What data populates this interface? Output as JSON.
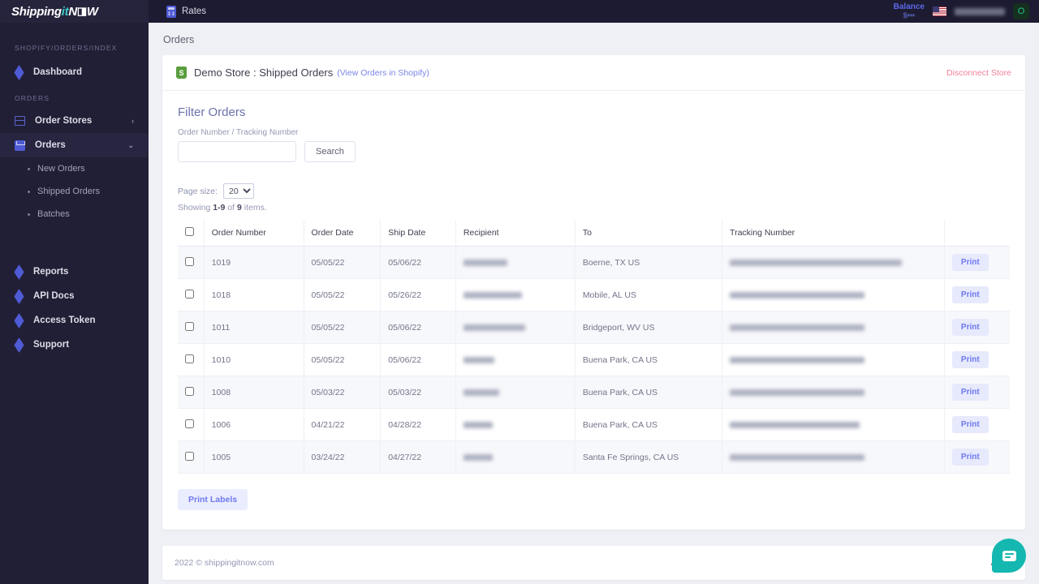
{
  "brand": {
    "part1": "Shipping",
    "part2": "it",
    "part3": "N",
    "part4": "W"
  },
  "topnav": {
    "rates_label": "Rates"
  },
  "account": {
    "balance_label": "Balance",
    "balance_amount": "$•••",
    "avatar_initial": "O"
  },
  "sidebar": {
    "breadcrumb": "SHOPIFY/ORDERS/INDEX",
    "dashboard_label": "Dashboard",
    "orders_section": "ORDERS",
    "order_stores_label": "Order Stores",
    "orders_label": "Orders",
    "sub_items": [
      {
        "label": "New Orders"
      },
      {
        "label": "Shipped Orders"
      },
      {
        "label": "Batches"
      }
    ],
    "lower_items": [
      {
        "label": "Reports"
      },
      {
        "label": "API Docs"
      },
      {
        "label": "Access Token"
      },
      {
        "label": "Support"
      }
    ]
  },
  "page": {
    "title": "Orders"
  },
  "store_header": {
    "title": "Demo Store : Shipped Orders",
    "view_link": "(View Orders in Shopify)",
    "disconnect_label": "Disconnect Store"
  },
  "filter": {
    "heading": "Filter Orders",
    "field_label": "Order Number / Tracking Number",
    "input_value": "",
    "input_placeholder": "",
    "search_label": "Search"
  },
  "pagination": {
    "page_size_label": "Page size:",
    "page_size_value": "20",
    "page_size_options": [
      "20"
    ],
    "showing_prefix": "Showing ",
    "showing_range": "1-9",
    "showing_of": " of ",
    "showing_total": "9",
    "showing_suffix": " items."
  },
  "table": {
    "columns": [
      "Order Number",
      "Order Date",
      "Ship Date",
      "Recipient",
      "To",
      "Tracking Number"
    ],
    "rows": [
      {
        "order_number": "1019",
        "order_date": "05/05/22",
        "ship_date": "05/06/22",
        "recipient": "",
        "to": "Boerne, TX US",
        "tracking": "",
        "action": "Print",
        "recipient_w": 54,
        "tracking_w": 212
      },
      {
        "order_number": "1018",
        "order_date": "05/05/22",
        "ship_date": "05/26/22",
        "recipient": "",
        "to": "Mobile, AL US",
        "tracking": "",
        "action": "Print",
        "recipient_w": 72,
        "tracking_w": 166
      },
      {
        "order_number": "1011",
        "order_date": "05/05/22",
        "ship_date": "05/06/22",
        "recipient": "",
        "to": "Bridgeport, WV US",
        "tracking": "",
        "action": "Print",
        "recipient_w": 76,
        "tracking_w": 166
      },
      {
        "order_number": "1010",
        "order_date": "05/05/22",
        "ship_date": "05/06/22",
        "recipient": "",
        "to": "Buena Park, CA US",
        "tracking": "",
        "action": "Print",
        "recipient_w": 38,
        "tracking_w": 166
      },
      {
        "order_number": "1008",
        "order_date": "05/03/22",
        "ship_date": "05/03/22",
        "recipient": "",
        "to": "Buena Park, CA US",
        "tracking": "",
        "action": "Print",
        "recipient_w": 44,
        "tracking_w": 166
      },
      {
        "order_number": "1006",
        "order_date": "04/21/22",
        "ship_date": "04/28/22",
        "recipient": "",
        "to": "Buena Park, CA US",
        "tracking": "",
        "action": "Print",
        "recipient_w": 36,
        "tracking_w": 160
      },
      {
        "order_number": "1005",
        "order_date": "03/24/22",
        "ship_date": "04/27/22",
        "recipient": "",
        "to": "Santa Fe Springs, CA US",
        "tracking": "",
        "action": "Print",
        "recipient_w": 36,
        "tracking_w": 166
      }
    ],
    "print_labels_button": "Print Labels"
  },
  "footer": {
    "copyright": "2022 © shippingitnow.com",
    "about": "About"
  },
  "colors": {
    "sidebar_bg": "#211f35",
    "topbar_bg": "#1d1b31",
    "accent_blue": "#4f5bd5",
    "brand_teal": "#3ec6c6",
    "danger_pink": "#f4809a",
    "chat_teal": "#14b8b0",
    "shopify_green": "#5a9e3f"
  }
}
